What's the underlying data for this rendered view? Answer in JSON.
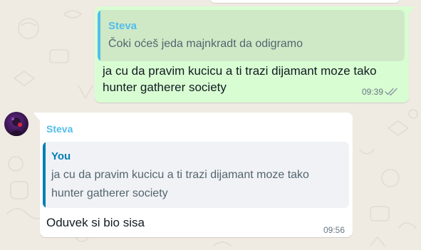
{
  "theme": {
    "wallpaper_color": "#efeae2",
    "outgoing_bubble_color": "#d9fdd3",
    "incoming_bubble_color": "#ffffff",
    "name_color": "#53bdeb",
    "read_tick_color": "#8696a0"
  },
  "outgoing_message": {
    "quote": {
      "sender": "Steva",
      "text": "Čoki oćeš jeda majnkradt da odigramo"
    },
    "text": "ja cu da pravim kucicu a ti trazi dijamant moze tako hunter gatherer society",
    "time": "09:39",
    "status_icon": "double-check-icon"
  },
  "incoming_message": {
    "sender": "Steva",
    "avatar_icon": "contact-avatar",
    "quote": {
      "sender": "You",
      "text": "ja cu da pravim kucicu a ti trazi dijamant moze tako hunter gatherer society"
    },
    "text": "Oduvek si bio sisa",
    "time": "09:56"
  }
}
